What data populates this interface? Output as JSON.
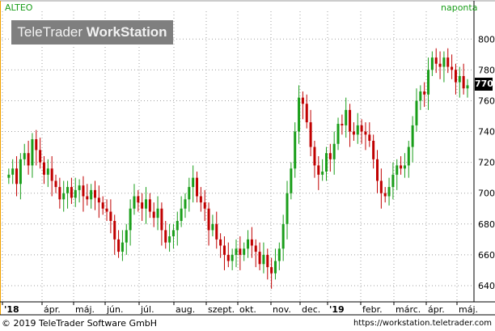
{
  "header": {
    "ticker": "ALTEO",
    "frequency": "naponta",
    "badge_light": "TeleTrader ",
    "badge_bold": "WorkStation"
  },
  "footer": {
    "copyright": "© 2019 TeleTrader Software GmbH",
    "url": "https://workstation.teletrader.com"
  },
  "current_price": "770",
  "colors": {
    "up": "#1a9e1a",
    "down": "#c00000",
    "grid": "#a0a0a0"
  },
  "chart_data": {
    "type": "candlestick",
    "title": "",
    "xlabel": "",
    "ylabel": "",
    "ylim": [
      630,
      818
    ],
    "yticks": [
      640,
      660,
      680,
      700,
      720,
      740,
      760,
      780,
      800
    ],
    "x_tick_labels": [
      "'18",
      "ápr.",
      "máj.",
      "jún.",
      "júl.",
      "aug.",
      "szept.",
      "okt.",
      "nov.",
      "dec.",
      "'19",
      "febr.",
      "márc.",
      "ápr.",
      "máj."
    ],
    "grid": true,
    "axis_position": "right",
    "approx_daily_close": [
      [
        2,
        712
      ],
      [
        4,
        716
      ],
      [
        6,
        706
      ],
      [
        8,
        722
      ],
      [
        10,
        726
      ],
      [
        12,
        718
      ],
      [
        14,
        735
      ],
      [
        16,
        728
      ],
      [
        18,
        720
      ],
      [
        20,
        712
      ],
      [
        22,
        716
      ],
      [
        24,
        708
      ],
      [
        26,
        704
      ],
      [
        28,
        696
      ],
      [
        30,
        700
      ],
      [
        32,
        704
      ],
      [
        34,
        697
      ],
      [
        36,
        702
      ],
      [
        38,
        705
      ],
      [
        40,
        698
      ],
      [
        42,
        696
      ],
      [
        44,
        702
      ],
      [
        46,
        697
      ],
      [
        48,
        694
      ],
      [
        50,
        690
      ],
      [
        52,
        688
      ],
      [
        54,
        682
      ],
      [
        56,
        670
      ],
      [
        58,
        662
      ],
      [
        60,
        668
      ],
      [
        62,
        676
      ],
      [
        64,
        690
      ],
      [
        66,
        698
      ],
      [
        68,
        694
      ],
      [
        70,
        690
      ],
      [
        72,
        696
      ],
      [
        74,
        688
      ],
      [
        76,
        684
      ],
      [
        78,
        690
      ],
      [
        80,
        676
      ],
      [
        82,
        668
      ],
      [
        84,
        672
      ],
      [
        86,
        676
      ],
      [
        88,
        682
      ],
      [
        90,
        690
      ],
      [
        92,
        696
      ],
      [
        94,
        704
      ],
      [
        96,
        710
      ],
      [
        98,
        698
      ],
      [
        100,
        694
      ],
      [
        102,
        690
      ],
      [
        104,
        676
      ],
      [
        106,
        680
      ],
      [
        108,
        670
      ],
      [
        110,
        666
      ],
      [
        112,
        660
      ],
      [
        114,
        656
      ],
      [
        116,
        660
      ],
      [
        118,
        664
      ],
      [
        120,
        660
      ],
      [
        122,
        664
      ],
      [
        124,
        670
      ],
      [
        126,
        666
      ],
      [
        128,
        662
      ],
      [
        130,
        654
      ],
      [
        132,
        660
      ],
      [
        134,
        652
      ],
      [
        136,
        648
      ],
      [
        138,
        656
      ],
      [
        140,
        664
      ],
      [
        142,
        680
      ],
      [
        144,
        700
      ],
      [
        146,
        716
      ],
      [
        148,
        740
      ],
      [
        150,
        762
      ],
      [
        152,
        758
      ],
      [
        154,
        746
      ],
      [
        156,
        730
      ],
      [
        158,
        718
      ],
      [
        160,
        712
      ],
      [
        162,
        714
      ],
      [
        164,
        726
      ],
      [
        166,
        722
      ],
      [
        168,
        732
      ],
      [
        170,
        745
      ],
      [
        172,
        744
      ],
      [
        174,
        754
      ],
      [
        176,
        740
      ],
      [
        178,
        738
      ],
      [
        180,
        744
      ],
      [
        182,
        740
      ],
      [
        184,
        738
      ],
      [
        186,
        734
      ],
      [
        188,
        722
      ],
      [
        190,
        708
      ],
      [
        192,
        700
      ],
      [
        194,
        698
      ],
      [
        196,
        704
      ],
      [
        198,
        712
      ],
      [
        200,
        718
      ],
      [
        202,
        716
      ],
      [
        204,
        718
      ],
      [
        206,
        730
      ],
      [
        208,
        744
      ],
      [
        210,
        760
      ],
      [
        212,
        766
      ],
      [
        214,
        764
      ],
      [
        216,
        780
      ],
      [
        218,
        788
      ],
      [
        220,
        784
      ],
      [
        222,
        782
      ],
      [
        224,
        788
      ],
      [
        226,
        782
      ],
      [
        228,
        780
      ],
      [
        230,
        772
      ],
      [
        232,
        776
      ],
      [
        234,
        768
      ],
      [
        236,
        770
      ]
    ]
  }
}
